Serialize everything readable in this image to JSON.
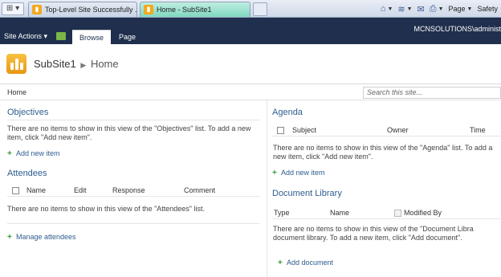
{
  "browser": {
    "tabs": [
      {
        "title": "Top-Level Site Successfully ..."
      },
      {
        "title": "Home - SubSite1"
      }
    ],
    "tools": {
      "page": "Page",
      "safety": "Safety"
    }
  },
  "ribbon": {
    "site_actions": "Site Actions",
    "tabs": [
      "Browse",
      "Page"
    ],
    "user": "MCNSOLUTIONS\\administ"
  },
  "title_area": {
    "site_name": "SubSite1",
    "page_name": "Home"
  },
  "top_nav": {
    "home": "Home",
    "search_placeholder": "Search this site..."
  },
  "left": {
    "objectives": {
      "title": "Objectives",
      "empty_message": "There are no items to show in this view of the \"Objectives\" list. To add a new item, click \"Add new item\".",
      "add_label": "Add new item"
    },
    "attendees": {
      "title": "Attendees",
      "columns": [
        "Name",
        "Edit",
        "Response",
        "Comment"
      ],
      "empty_message": "There are no items to show in this view of the \"Attendees\" list.",
      "manage_label": "Manage attendees"
    }
  },
  "right": {
    "agenda": {
      "title": "Agenda",
      "columns": [
        "Subject",
        "Owner",
        "Time"
      ],
      "empty_message": "There are no items to show in this view of the \"Agenda\" list. To add a new item, click \"Add new item\".",
      "add_label": "Add new item"
    },
    "documents": {
      "title": "Document Library",
      "columns": [
        "Type",
        "Name",
        "Modified By"
      ],
      "empty_message": "There are no items to show in this view of the \"Document Libra document library. To add a new item, click \"Add document\".",
      "add_label": "Add document"
    }
  },
  "colors": {
    "ribbon_bg": "#1f2f4d",
    "link": "#2e5d8f",
    "active_tab": "#7fd8bf",
    "logo": "#f3a81e"
  }
}
